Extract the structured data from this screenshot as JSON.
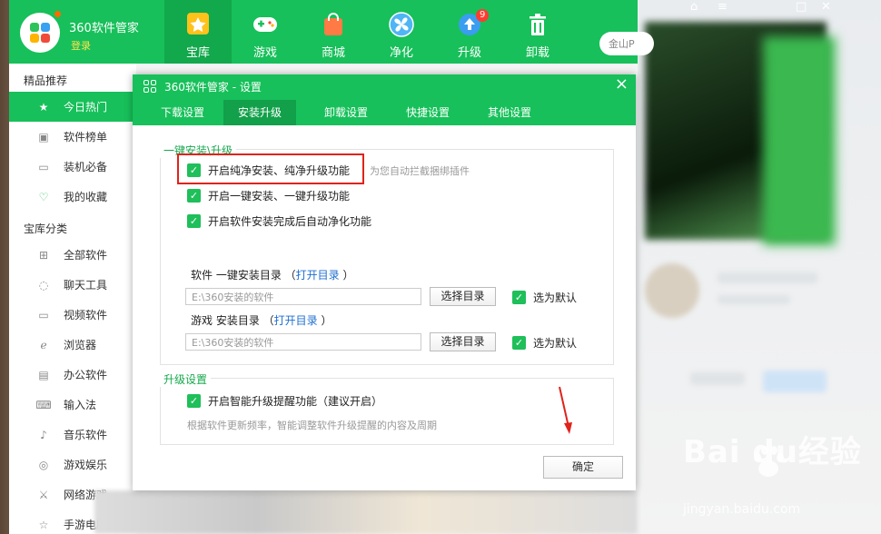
{
  "app": {
    "name": "360软件管家",
    "login": "登录"
  },
  "nav": [
    {
      "label": "宝库",
      "icon": "star-icon"
    },
    {
      "label": "游戏",
      "icon": "gamepad-icon"
    },
    {
      "label": "商城",
      "icon": "shopping-bag-icon"
    },
    {
      "label": "净化",
      "icon": "fan-icon"
    },
    {
      "label": "升级",
      "icon": "upload-arrow-icon",
      "badge": "9"
    },
    {
      "label": "卸载",
      "icon": "trash-icon"
    }
  ],
  "search": {
    "placeholder": "金山P"
  },
  "sidebar": {
    "section1": "精品推荐",
    "items1": [
      "今日热门",
      "软件榜单",
      "装机必备",
      "我的收藏"
    ],
    "section2": "宝库分类",
    "items2": [
      "全部软件",
      "聊天工具",
      "视频软件",
      "浏览器",
      "办公软件",
      "输入法",
      "音乐软件",
      "游戏娱乐",
      "网络游戏",
      "手游电脑"
    ]
  },
  "dialog": {
    "title": "360软件管家 - 设置",
    "tabs": [
      "下载设置",
      "安装升级",
      "卸载设置",
      "快捷设置",
      "其他设置"
    ],
    "group1": {
      "title": "一键安装\\升级",
      "opt1": "开启纯净安装、纯净升级功能",
      "opt1_hint": "为您自动拦截捆绑插件",
      "opt2": "开启一键安装、一键升级功能",
      "opt3": "开启软件安装完成后自动净化功能",
      "soft_dir_label": "软件 一键安装目录 （",
      "open_dir": "打开目录",
      "close_paren": "）",
      "soft_dir_value": "E:\\360安装的软件",
      "choose_dir": "选择目录",
      "set_default": "选为默认",
      "game_dir_label": "游戏 安装目录 （",
      "game_dir_value": "E:\\360安装的软件"
    },
    "group2": {
      "title": "升级设置",
      "opt1": "开启智能升级提醒功能（建议开启）",
      "desc": "根据软件更新频率，智能调整软件升级提醒的内容及周期"
    },
    "ok": "确定"
  },
  "watermark": {
    "brand": "Bai  du经验",
    "url": "jingyan.baidu.com"
  }
}
